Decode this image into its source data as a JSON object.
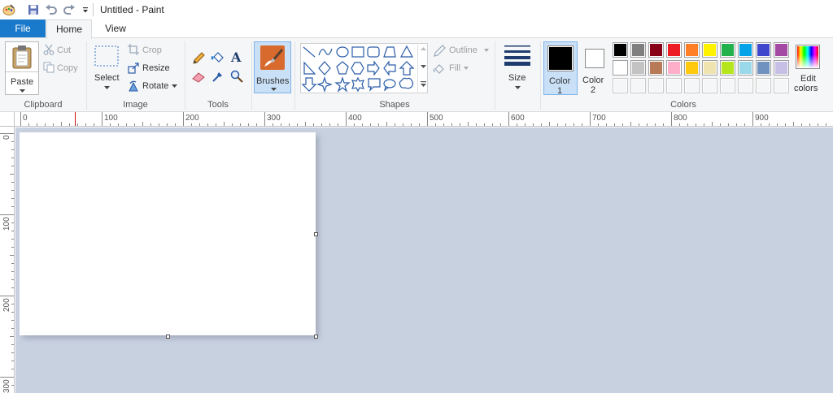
{
  "window": {
    "title": "Untitled - Paint"
  },
  "quick_access": {
    "icons": [
      "paint-app-icon",
      "save-icon",
      "undo-icon",
      "redo-icon",
      "customize-dropdown-icon"
    ]
  },
  "tabs": [
    {
      "label": "File"
    },
    {
      "label": "Home"
    },
    {
      "label": "View"
    }
  ],
  "ribbon": {
    "clipboard": {
      "paste": "Paste",
      "cut": "Cut",
      "copy": "Copy",
      "group_label": "Clipboard"
    },
    "image": {
      "select": "Select",
      "crop": "Crop",
      "resize": "Resize",
      "rotate": "Rotate",
      "group_label": "Image"
    },
    "tools": {
      "group_label": "Tools"
    },
    "brushes": {
      "label": "Brushes"
    },
    "shapes": {
      "outline": "Outline",
      "fill": "Fill",
      "group_label": "Shapes"
    },
    "size": {
      "label": "Size"
    },
    "colors": {
      "color1_line1": "Color",
      "color1_line2": "1",
      "color2_line1": "Color",
      "color2_line2": "2",
      "edit_line1": "Edit",
      "edit_line2": "colors",
      "group_label": "Colors",
      "color1_value": "#000000",
      "color2_value": "#ffffff",
      "palette_row1": [
        "#000000",
        "#7f7f7f",
        "#880015",
        "#ed1c24",
        "#ff7f27",
        "#fff200",
        "#22b14c",
        "#00a2e8",
        "#3f48cc",
        "#a349a4"
      ],
      "palette_row2": [
        "#ffffff",
        "#c3c3c3",
        "#b97a57",
        "#ffaec9",
        "#ffc90e",
        "#efe4b0",
        "#b5e61d",
        "#99d9ea",
        "#7092be",
        "#c8bfe7"
      ]
    }
  },
  "rulers": {
    "horizontal": [
      "0",
      "100",
      "200",
      "300",
      "400",
      "500",
      "600",
      "700",
      "800",
      "900"
    ],
    "vertical": [
      "0",
      "100",
      "200",
      "300"
    ]
  },
  "colors": {
    "accent": "#1979ca",
    "workspace": "#c8d1e0",
    "selected_button": "#c9e0f7"
  }
}
